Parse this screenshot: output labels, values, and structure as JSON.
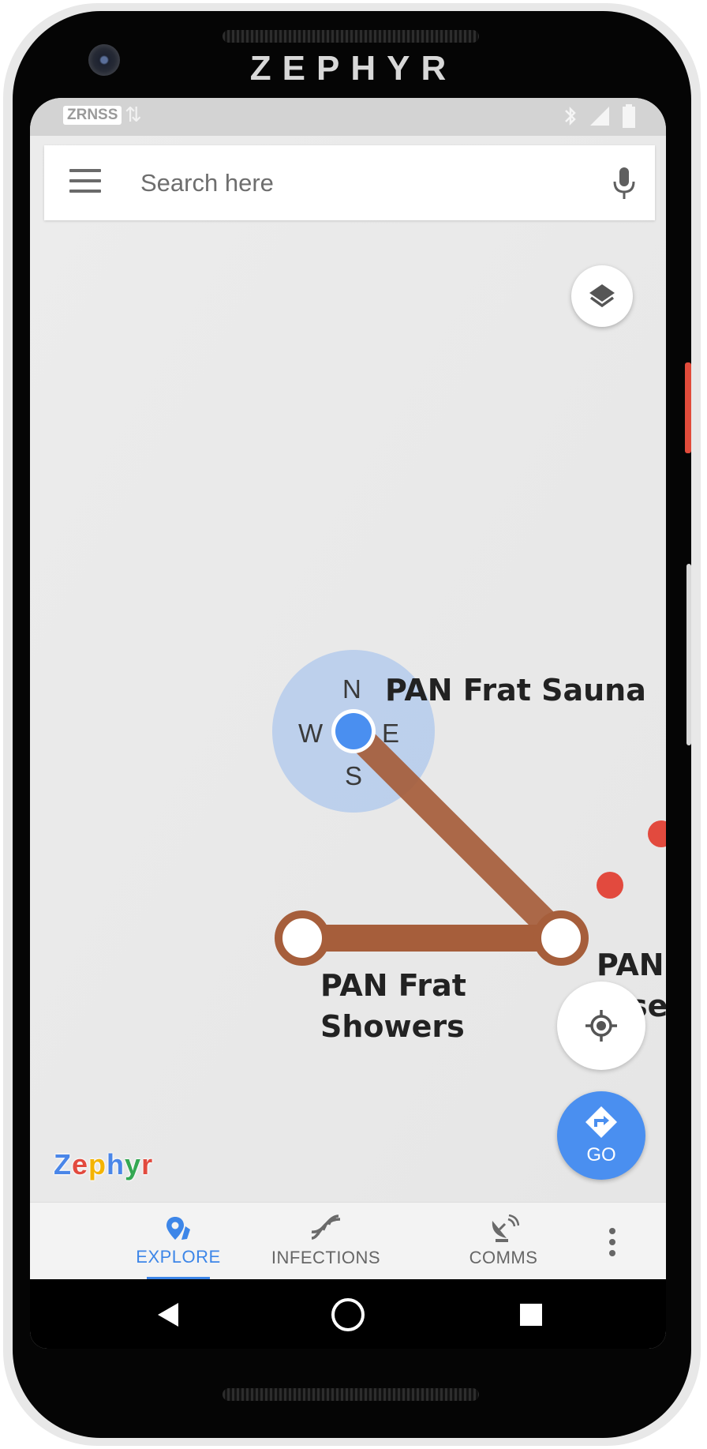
{
  "device": {
    "brand": "ZEPHYR"
  },
  "status_bar": {
    "carrier": "ZRNSS",
    "icons": [
      "data-arrows-icon",
      "bluetooth-icon",
      "signal-icon",
      "battery-icon"
    ]
  },
  "search": {
    "placeholder": "Search here",
    "menu_icon": "hamburger-menu-icon",
    "mic_icon": "microphone-icon"
  },
  "map": {
    "compass": {
      "n": "N",
      "e": "E",
      "s": "S",
      "w": "W"
    },
    "places": [
      {
        "id": "sauna",
        "name": "PAN Frat Sauna"
      },
      {
        "id": "showers",
        "name_line1": "PAN Frat",
        "name_line2": "Showers"
      },
      {
        "id": "partial",
        "name_line1": "PAN",
        "name_line2": "se"
      }
    ],
    "route_color": "#a65e3b",
    "user_dot_color": "#4a8ff0",
    "infection_dot_color": "#e24a3e",
    "logo": "Zephyr"
  },
  "buttons": {
    "layers_icon": "layers-icon",
    "locate_icon": "my-location-icon",
    "go_label": "GO"
  },
  "bottom_nav": {
    "items": [
      {
        "label": "EXPLORE",
        "icon": "map-pin-icon",
        "active": true
      },
      {
        "label": "INFECTIONS",
        "icon": "dna-icon",
        "active": false
      },
      {
        "label": "COMMS",
        "icon": "satellite-dish-icon",
        "active": false
      }
    ],
    "overflow_icon": "more-vert-icon"
  },
  "android_nav": {
    "icons": [
      "back-icon",
      "home-icon",
      "recents-icon"
    ]
  }
}
